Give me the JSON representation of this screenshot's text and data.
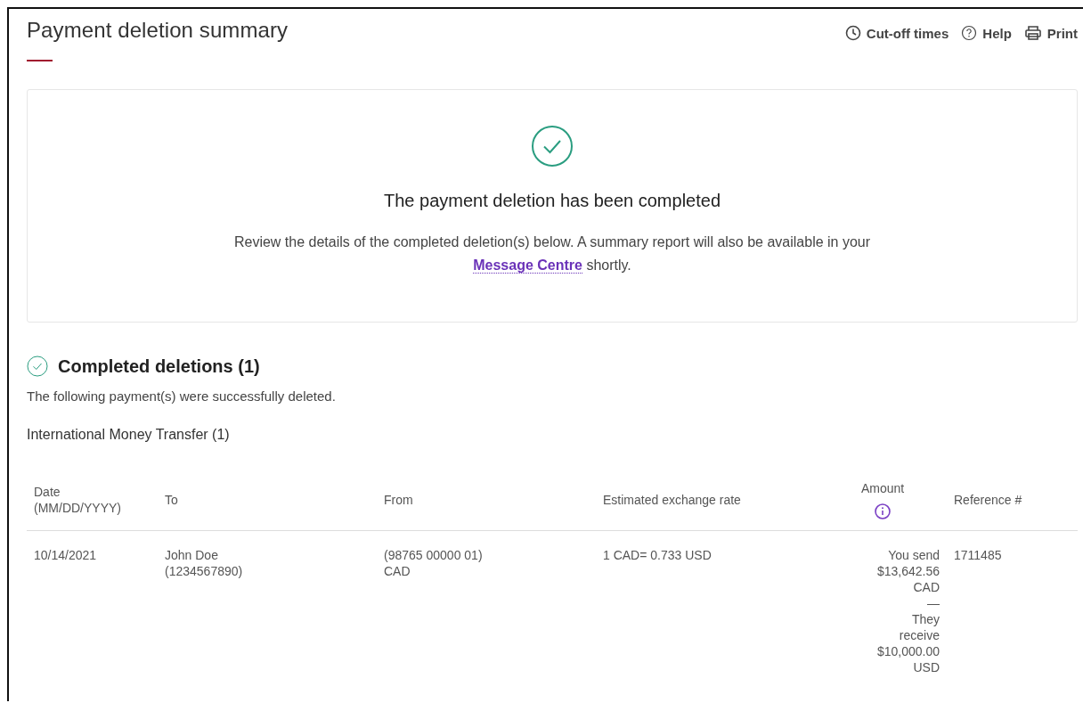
{
  "page": {
    "title": "Payment deletion summary"
  },
  "toolbar": [
    {
      "kind": "clock",
      "label": "Cut-off times"
    },
    {
      "kind": "help",
      "label": "Help"
    },
    {
      "kind": "print",
      "label": "Print"
    }
  ],
  "confirmation": {
    "heading": "The payment deletion has been completed",
    "message": "Review the details of the completed deletion(s) below. A summary report will also be available in your ",
    "link": "Message Centre",
    "message_end": " shortly."
  },
  "section": {
    "heading": "Completed deletions (1)",
    "description": "The following payment(s) were successfully deleted.",
    "group": "International Money Transfer (1)"
  },
  "table": {
    "columns": [
      {
        "label": "Date (MM/DD/YYYY)",
        "kind": "text"
      },
      {
        "label": "To",
        "kind": "text"
      },
      {
        "label": "From",
        "kind": "text"
      },
      {
        "label": "Estimated exchange rate",
        "kind": "text"
      },
      {
        "label": "Amount",
        "kind": "info"
      },
      {
        "label": "Reference #",
        "kind": "text"
      }
    ],
    "rows": [
      {
        "date": "10/14/2021",
        "to_name": "John Doe",
        "to_account": "(1234567890)",
        "from_account": "(98765 00000 01)",
        "from_currency": "CAD",
        "rate": "1 CAD= 0.733 USD",
        "send": "You send $13,642.56 CAD",
        "separator": "—",
        "receive": "They receive $10,000.00 USD",
        "reference": "1711485"
      }
    ]
  }
}
